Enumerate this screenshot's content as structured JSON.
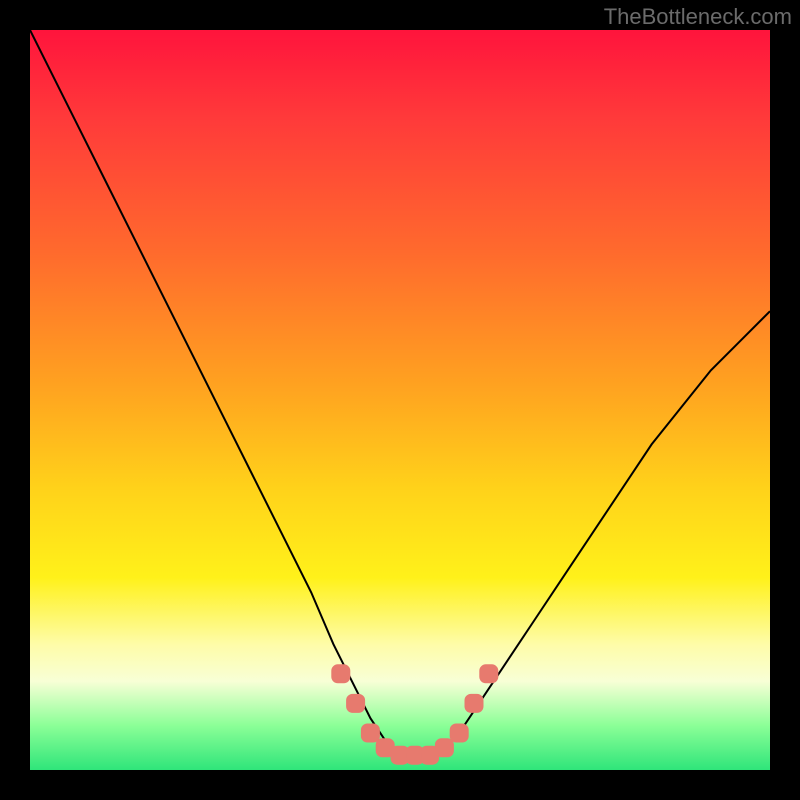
{
  "watermark": "TheBottleneck.com",
  "chart_data": {
    "type": "line",
    "title": "",
    "xlabel": "",
    "ylabel": "",
    "xlim": [
      0,
      100
    ],
    "ylim": [
      0,
      100
    ],
    "grid": false,
    "legend": false,
    "background_gradient": {
      "direction": "vertical",
      "stops": [
        {
          "pos": 0.0,
          "color": "#ff143c"
        },
        {
          "pos": 0.3,
          "color": "#ff6a2d"
        },
        {
          "pos": 0.6,
          "color": "#ffd21a"
        },
        {
          "pos": 0.83,
          "color": "#fefca8"
        },
        {
          "pos": 1.0,
          "color": "#2fe57a"
        }
      ]
    },
    "series": [
      {
        "name": "bottleneck-curve",
        "color": "#000000",
        "stroke_width": 2,
        "x": [
          0,
          3,
          6,
          10,
          14,
          18,
          22,
          26,
          30,
          34,
          38,
          41,
          44,
          46,
          48,
          50,
          52,
          54,
          56,
          58,
          60,
          64,
          68,
          72,
          76,
          80,
          84,
          88,
          92,
          96,
          100
        ],
        "y": [
          100,
          94,
          88,
          80,
          72,
          64,
          56,
          48,
          40,
          32,
          24,
          17,
          11,
          7,
          4,
          2,
          2,
          2,
          3,
          5,
          8,
          14,
          20,
          26,
          32,
          38,
          44,
          49,
          54,
          58,
          62
        ]
      }
    ],
    "markers": {
      "name": "valley-markers",
      "shape": "rounded-rect",
      "fill": "#e77a6e",
      "stroke": "#e77a6e",
      "points_x": [
        42,
        44,
        46,
        48,
        50,
        52,
        54,
        56,
        58,
        60,
        62
      ],
      "points_y": [
        13,
        9,
        5,
        3,
        2,
        2,
        2,
        3,
        5,
        9,
        13
      ]
    }
  }
}
